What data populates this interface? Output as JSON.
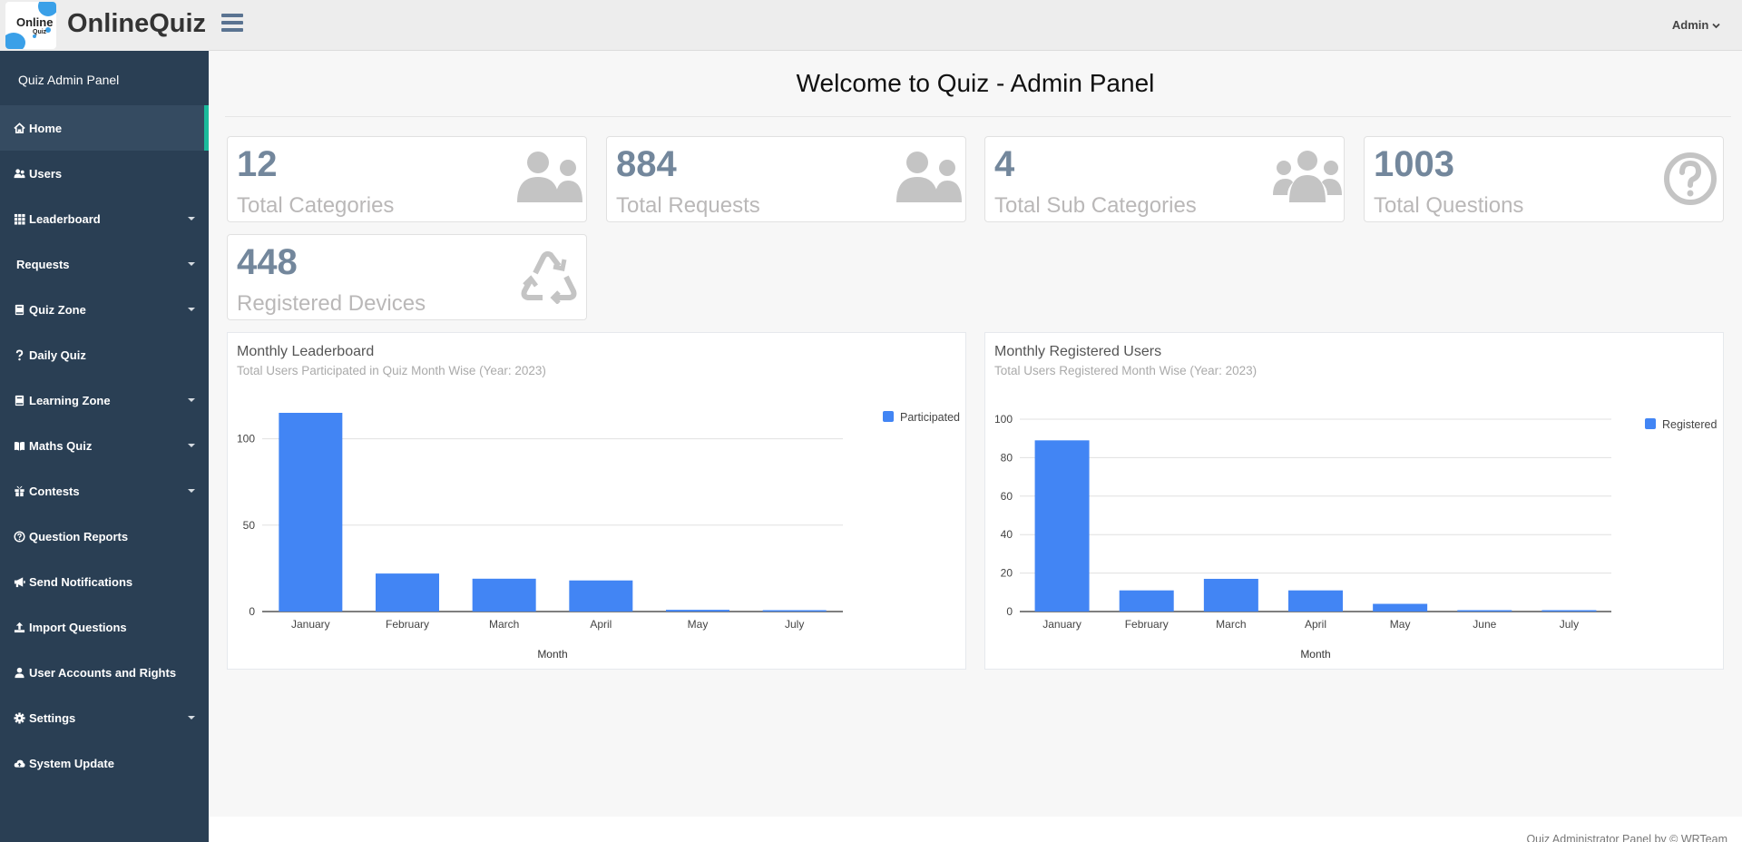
{
  "brand": {
    "logo_line1": "Online",
    "logo_line2": "Quiz",
    "name": "OnlineQuiz"
  },
  "header": {
    "user_menu": "Admin"
  },
  "sidebar": {
    "title": "Quiz Admin Panel",
    "items": [
      {
        "label": "Home",
        "icon": "home-icon",
        "dropdown": false,
        "active": true
      },
      {
        "label": "Users",
        "icon": "users-icon",
        "dropdown": false
      },
      {
        "label": "Leaderboard",
        "icon": "grid-icon",
        "dropdown": true
      },
      {
        "label": "Requests",
        "icon": "",
        "dropdown": true
      },
      {
        "label": "Quiz Zone",
        "icon": "book-icon",
        "dropdown": true
      },
      {
        "label": "Daily Quiz",
        "icon": "question-icon",
        "dropdown": false
      },
      {
        "label": "Learning Zone",
        "icon": "book-icon",
        "dropdown": true
      },
      {
        "label": "Maths Quiz",
        "icon": "open-book-icon",
        "dropdown": true
      },
      {
        "label": "Contests",
        "icon": "gift-icon",
        "dropdown": true
      },
      {
        "label": "Question Reports",
        "icon": "question-circle-icon",
        "dropdown": false
      },
      {
        "label": "Send Notifications",
        "icon": "bullhorn-icon",
        "dropdown": false
      },
      {
        "label": "Import Questions",
        "icon": "upload-icon",
        "dropdown": false
      },
      {
        "label": "User Accounts and Rights",
        "icon": "user-icon",
        "dropdown": false
      },
      {
        "label": "Settings",
        "icon": "gear-icon",
        "dropdown": true
      },
      {
        "label": "System Update",
        "icon": "cloud-icon",
        "dropdown": false
      }
    ]
  },
  "main": {
    "title": "Welcome to Quiz - Admin Panel",
    "stats": [
      {
        "count": "12",
        "label": "Total Categories",
        "icon": "users-icon"
      },
      {
        "count": "884",
        "label": "Total Requests",
        "icon": "users-icon"
      },
      {
        "count": "4",
        "label": "Total Sub Categories",
        "icon": "users-icon"
      },
      {
        "count": "1003",
        "label": "Total Questions",
        "icon": "question-circle-icon"
      },
      {
        "count": "448",
        "label": "Registered Devices",
        "icon": "recycle-icon"
      }
    ]
  },
  "colors": {
    "sidebar_bg": "#2a3f54",
    "accent": "#1abb9c",
    "bar": "#4285f4",
    "stat_count": "#73879c",
    "stat_label": "#bab8b8"
  },
  "chart_data": [
    {
      "type": "bar",
      "title": "Monthly Leaderboard",
      "subtitle": "Total Users Participated in Quiz Month Wise (Year: 2023)",
      "categories": [
        "January",
        "February",
        "March",
        "April",
        "May",
        "July"
      ],
      "series": [
        {
          "name": "Participated",
          "values": [
            115,
            22,
            19,
            18,
            1,
            0
          ]
        }
      ],
      "xlabel": "Month",
      "ylabel": "",
      "ylim": [
        0,
        115
      ],
      "yticks": [
        0,
        50,
        100
      ],
      "grid": true,
      "legend": "top-right"
    },
    {
      "type": "bar",
      "title": "Monthly Registered Users",
      "subtitle": "Total Users Registered Month Wise (Year: 2023)",
      "categories": [
        "January",
        "February",
        "March",
        "April",
        "May",
        "June",
        "July"
      ],
      "series": [
        {
          "name": "Registered",
          "values": [
            89,
            11,
            17,
            11,
            4,
            0,
            0
          ]
        }
      ],
      "xlabel": "Month",
      "ylabel": "",
      "ylim": [
        0,
        100
      ],
      "yticks": [
        0,
        20,
        40,
        60,
        80,
        100
      ],
      "grid": true,
      "legend": "top-right"
    }
  ],
  "footer": {
    "text": "Quiz Administrator Panel by © WRTeam"
  }
}
